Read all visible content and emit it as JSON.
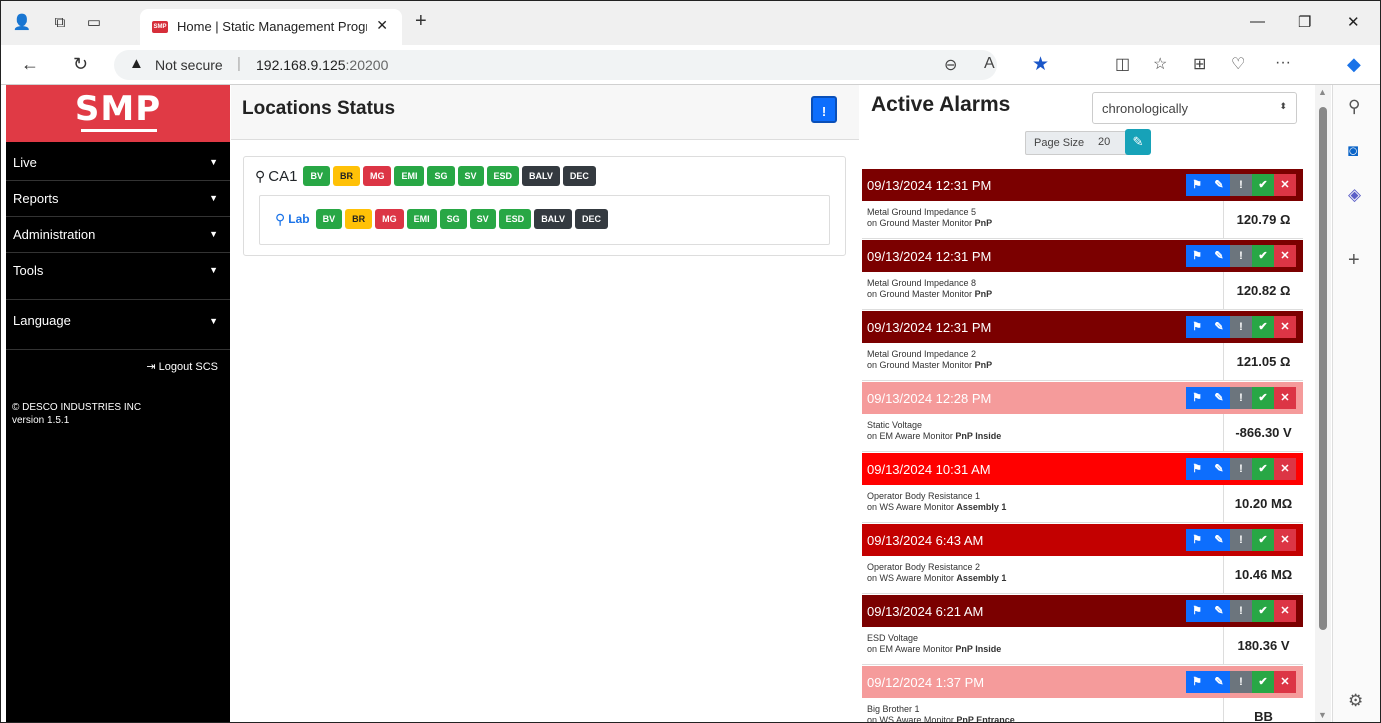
{
  "browser": {
    "tab_title": "Home | Static Management Progr",
    "favicon_text": "SMP",
    "tab_close": "✕",
    "new_tab": "+",
    "not_secure": "Not secure",
    "url_host": "192.168.9.125",
    "url_port": ":20200",
    "more": "···"
  },
  "sidebar": {
    "brand": "SMP",
    "items": [
      {
        "label": "Live"
      },
      {
        "label": "Reports"
      },
      {
        "label": "Administration"
      },
      {
        "label": "Tools"
      },
      {
        "label": "Language"
      }
    ],
    "logout": "Logout SCS",
    "copyright": "© DESCO INDUSTRIES INC",
    "version": "version 1.5.1"
  },
  "locations": {
    "title": "Locations Status",
    "root": {
      "name": "CA1",
      "badges": [
        "BV",
        "BR",
        "MG",
        "EMI",
        "SG",
        "SV",
        "ESD",
        "BALV",
        "DEC"
      ]
    },
    "child": {
      "name": "Lab",
      "badges": [
        "BV",
        "BR",
        "MG",
        "EMI",
        "SG",
        "SV",
        "ESD",
        "BALV",
        "DEC"
      ]
    }
  },
  "alarms": {
    "title": "Active Alarms",
    "sort": "chronologically",
    "page_size_label": "Page Size",
    "page_size": "20",
    "colors": {
      "dark": "#7b0000",
      "light": "#f59b9b",
      "bright": "#ff0000",
      "medium": "#c30000"
    },
    "items": [
      {
        "datetime": "09/13/2024 12:31 PM",
        "line1": "Metal Ground Impedance 5",
        "line2_prefix": "on Ground Master Monitor ",
        "line2_bold": "PnP",
        "value": "120.79 Ω"
      },
      {
        "datetime": "09/13/2024 12:31 PM",
        "line1": "Metal Ground Impedance 8",
        "line2_prefix": "on Ground Master Monitor ",
        "line2_bold": "PnP",
        "value": "120.82 Ω"
      },
      {
        "datetime": "09/13/2024 12:31 PM",
        "line1": "Metal Ground Impedance 2",
        "line2_prefix": "on Ground Master Monitor ",
        "line2_bold": "PnP",
        "value": "121.05 Ω"
      },
      {
        "datetime": "09/13/2024 12:28 PM",
        "line1": "Static Voltage",
        "line2_prefix": "on EM Aware Monitor ",
        "line2_bold": "PnP Inside",
        "value": "-866.30 V"
      },
      {
        "datetime": "09/13/2024 10:31 AM",
        "line1": "Operator Body Resistance 1",
        "line2_prefix": "on WS Aware Monitor ",
        "line2_bold": "Assembly 1",
        "value": "10.20 MΩ"
      },
      {
        "datetime": "09/13/2024 6:43 AM",
        "line1": "Operator Body Resistance 2",
        "line2_prefix": "on WS Aware Monitor ",
        "line2_bold": "Assembly 1",
        "value": "10.46 MΩ"
      },
      {
        "datetime": "09/13/2024 6:21 AM",
        "line1": "ESD Voltage",
        "line2_prefix": "on EM Aware Monitor ",
        "line2_bold": "PnP Inside",
        "value": "180.36 V"
      },
      {
        "datetime": "09/12/2024 1:37 PM",
        "line1": "Big Brother 1",
        "line2_prefix": "on WS Aware Monitor ",
        "line2_bold": "PnP Entrance",
        "value": "BB"
      }
    ]
  }
}
